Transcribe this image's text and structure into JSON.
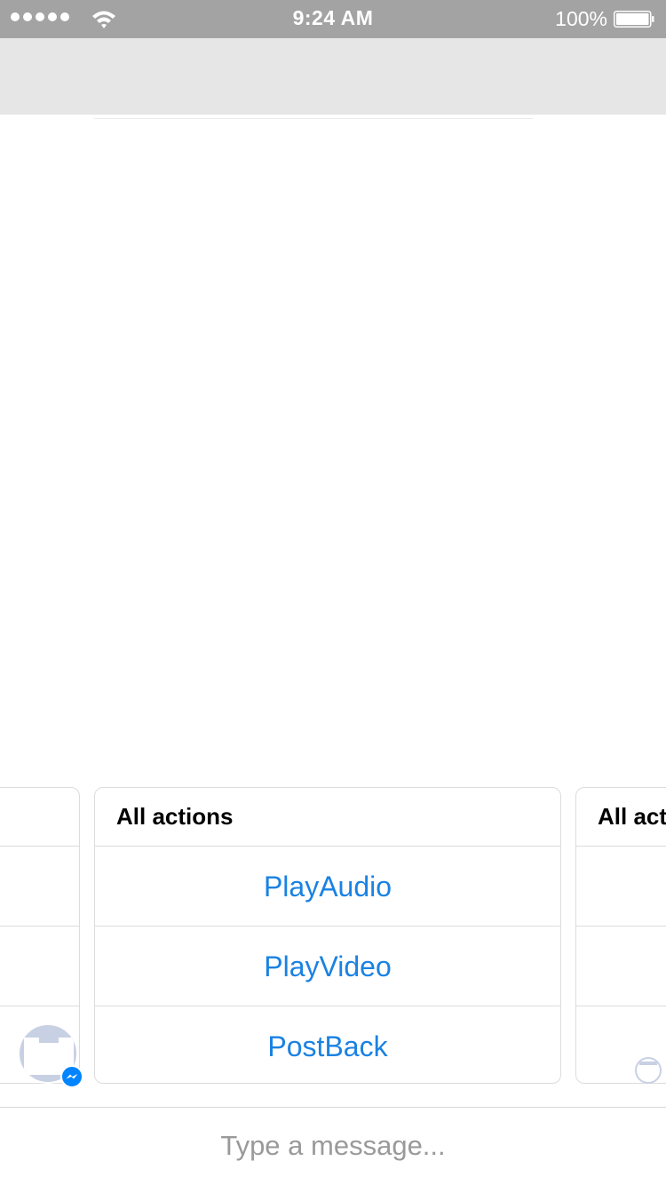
{
  "status_bar": {
    "time": "9:24 AM",
    "battery_percent": "100%",
    "signal_bars": 5,
    "battery_level": 1.0
  },
  "carousel": {
    "cards": [
      {
        "title": "",
        "actions": [
          "",
          "",
          ""
        ]
      },
      {
        "title": "All actions",
        "actions": [
          "PlayAudio",
          "PlayVideo",
          "PostBack"
        ]
      },
      {
        "title": "All act",
        "actions": [
          "",
          "",
          ""
        ]
      }
    ]
  },
  "composer": {
    "placeholder": "Type a message..."
  },
  "colors": {
    "accent": "#1a82e2",
    "status_bar": "#a3a3a3",
    "nav_bar": "#e6e6e6",
    "messenger": "#0084ff"
  },
  "icons": {
    "wifi": "wifi-icon",
    "battery": "battery-icon",
    "messenger": "messenger-icon"
  }
}
